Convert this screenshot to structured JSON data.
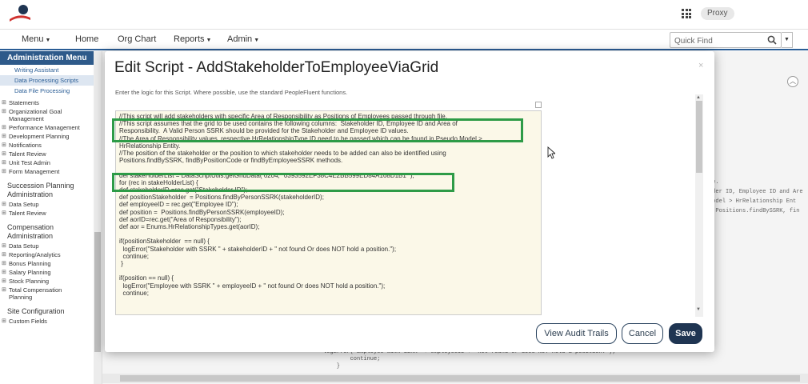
{
  "header": {
    "proxy_label": "Proxy"
  },
  "nav": {
    "items": [
      "Menu",
      "Home",
      "Org Chart",
      "Reports",
      "Admin"
    ],
    "quick_find_placeholder": "Quick Find"
  },
  "sidebar": {
    "title": "Administration Menu",
    "sub_items": [
      "Writing Assistant",
      "Data Processing Scripts",
      "Data File Processing"
    ],
    "items_a": [
      "Statements",
      "Organizational Goal Management",
      "Performance Management",
      "Development Planning",
      "Notifications",
      "Talent Review",
      "Unit Test Admin",
      "Form Management"
    ],
    "section_succession": "Succession Planning Administration",
    "items_b": [
      "Data Setup",
      "Talent Review"
    ],
    "section_compensation": "Compensation Administration",
    "items_c": [
      "Data Setup",
      "Reporting/Analytics",
      "Bonus Planning",
      "Salary Planning",
      "Stock Planning",
      "Total Compensation Planning"
    ],
    "section_site": "Site Configuration",
    "items_d": [
      "Custom Fields"
    ]
  },
  "background": {
    "code_lines": "logError( Employee with SSRK  + employeeID +  not found Or does NOT hold a position. );\n        continue;\n    }",
    "side_lines": "le.\nlder ID, Employee ID and Are\nModel > HrRelationship Ent\ng Positions.findBySSRK, fin"
  },
  "modal": {
    "title": "Edit Script - AddStakeholderToEmployeeViaGrid",
    "description": "Enter the logic for this Script. Where possible, use the standard PeopleFluent functions.",
    "code": "//This script will add stakeholders with specific Area of Responsibility as Positions of Employees passed through file.\n//This script assumes that the grid to be used contains the following columns:  Stakeholder ID, Employee ID and Area of\nResponsibility.  A Valid Person SSRK should be provided for the Stakeholder and Employee ID values.\n//The Area of Responsibility values, respective HrRelationshipType ID need to be passed which can be found in Pseudo Model >\nHrRelationship Entity.\n//The position of the stakeholder or the position to which stakeholder needs to be added can also be identified using\nPositions.findBySSRK, findByPositionCode or findByEmployeeSSRK methods.\n\ndef stakeHolderList = DataScriptUtils.getGridData( 6204, \"0393592EF38C4E2BB599ED84A168D1B1\" );\nfor (rec in stakeHolderList) {\ndef stakeholderID =rec.get(\"Stakeholder ID\");\ndef positionStakeholder  = Positions.findByPersonSSRK(stakeholderID);\ndef employeeID = rec.get(\"Employee ID\");\ndef position =  Positions.findByPersonSSRK(employeeID);\ndef aorID=rec.get(\"Area of Responsibility\");\ndef aor = Enums.HrRelationshipTypes.get(aorID);\n\nif(positionStakeholder  == null) {\n  logError(\"Stakeholder with SSRK \" + stakeholderID + \" not found Or does NOT hold a position.\");\n  continue;\n }\n\nif(position == null) {\n  logError(\"Employee with SSRK \" + employeeID + \" not found Or does NOT hold a position.\");\n  continue;",
    "buttons": {
      "audit": "View Audit Trails",
      "cancel": "Cancel",
      "save": "Save"
    }
  },
  "colors": {
    "brand_navy": "#1f3552",
    "sidebar_header": "#2e5a8a",
    "highlight_green": "#2e9b47",
    "editor_bg": "#fbf8e8"
  }
}
